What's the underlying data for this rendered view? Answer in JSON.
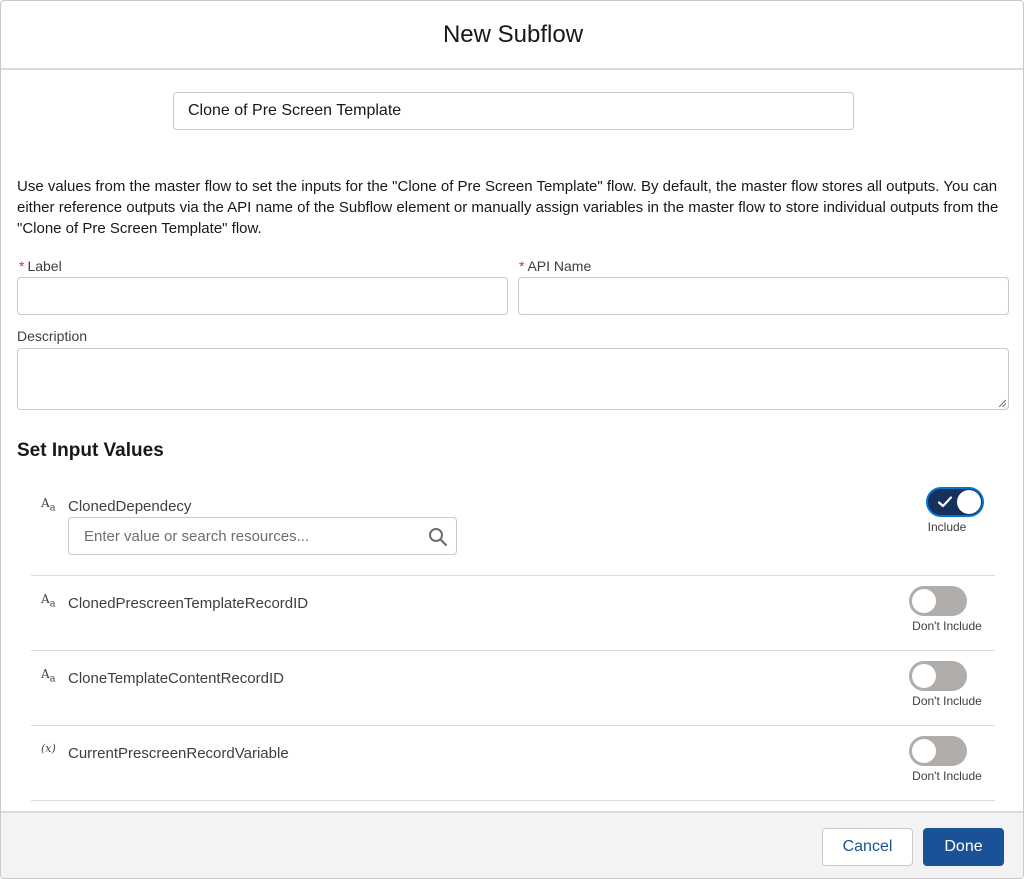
{
  "modal": {
    "title": "New Subflow",
    "subflow_name": "Clone of Pre Screen Template",
    "description": "Use values from the master flow to set the inputs for the \"Clone of Pre Screen Template\" flow. By default, the master flow stores all outputs. You can either reference outputs via the API name of the Subflow element or manually assign variables in the master flow to store individual outputs from the \"Clone of Pre Screen Template\" flow."
  },
  "form": {
    "required_mark": "*",
    "label_label": "Label",
    "label_value": "",
    "api_name_label": "API Name",
    "api_name_value": "",
    "description_label": "Description",
    "description_value": ""
  },
  "inputs_section": {
    "title": "Set Input Values",
    "search_placeholder": "Enter value or search resources...",
    "variables": [
      {
        "type_icon": "Aa",
        "name": "ClonedDependecy",
        "included": true,
        "status": "Include"
      },
      {
        "type_icon": "Aa",
        "name": "ClonedPrescreenTemplateRecordID",
        "included": false,
        "status": "Don't Include"
      },
      {
        "type_icon": "Aa",
        "name": "CloneTemplateContentRecordID",
        "included": false,
        "status": "Don't Include"
      },
      {
        "type_icon": "(x)",
        "name": "CurrentPrescreenRecordVariable",
        "included": false,
        "status": "Don't Include"
      }
    ]
  },
  "footer": {
    "cancel_label": "Cancel",
    "done_label": "Done"
  },
  "colors": {
    "brand": "#1b5297",
    "toggle_on": "#16325c",
    "toggle_off": "#b0adab",
    "required": "#c23934"
  }
}
